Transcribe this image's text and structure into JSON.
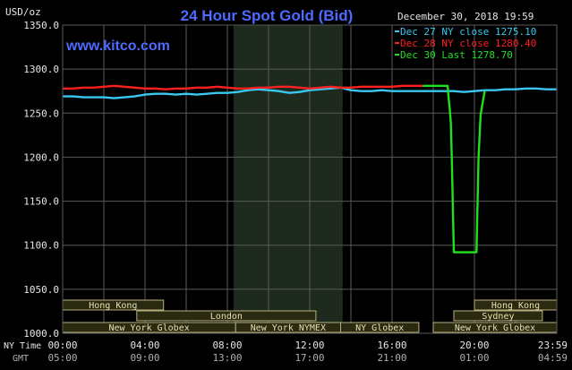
{
  "header": {
    "title": "24 Hour Spot Gold (Bid)",
    "date": "December 30, 2018 19:59",
    "unit": "USD/oz",
    "site": "www.kitco.com"
  },
  "colors": {
    "background": "#000000",
    "grid": "#5a5a5a",
    "title": "#4d6bff",
    "dec27": "#38c8f0",
    "dec28": "#ff2020",
    "dec30": "#20e020",
    "session_fill": "#1e2a1e",
    "market_bar": "#2a2a10",
    "market_border": "#b8b080",
    "market_text": "#e8e0b0",
    "axis_text": "#e6e6e6",
    "subtle_text": "#b0b0b0"
  },
  "legend": [
    {
      "label": "Dec 27 NY close 1275.10",
      "color": "#38c8f0"
    },
    {
      "label": "Dec 28 NY close 1280.40",
      "color": "#ff2020"
    },
    {
      "label": "Dec 30 Last 1278.70",
      "color": "#20e020"
    }
  ],
  "axis_labels": {
    "ny_time": "NY Time",
    "gmt": "GMT"
  },
  "chart_data": {
    "type": "line",
    "xlim": [
      0,
      24
    ],
    "ylim": [
      1000,
      1350
    ],
    "yticks": [
      1000,
      1050,
      1100,
      1150,
      1200,
      1250,
      1300,
      1350
    ],
    "ytick_labels": [
      "1000.0",
      "1050.0",
      "1100.0",
      "1150.0",
      "1200.0",
      "1250.0",
      "1300.0",
      "1350.0"
    ],
    "xticks": [
      0,
      4,
      8,
      12,
      16,
      20,
      23.983
    ],
    "xtick_labels": [
      "00:00",
      "04:00",
      "08:00",
      "12:00",
      "16:00",
      "20:00",
      "23:59"
    ],
    "gmt_labels": [
      "05:00",
      "09:00",
      "13:00",
      "17:00",
      "21:00",
      "01:00",
      "04:59"
    ],
    "grid": true,
    "shaded_session": [
      8.3,
      13.6
    ],
    "series": [
      {
        "name": "Dec 27 NY close 1275.10",
        "color": "#38c8f0",
        "x": [
          0,
          0.5,
          1,
          1.5,
          2,
          2.5,
          3,
          3.5,
          4,
          4.5,
          5,
          5.5,
          6,
          6.5,
          7,
          7.5,
          8,
          8.5,
          9,
          9.5,
          10,
          10.5,
          11,
          11.5,
          12,
          12.5,
          13,
          13.5,
          14,
          14.5,
          15,
          15.5,
          16,
          16.5,
          17,
          17.5,
          18,
          18.5,
          19,
          19.5,
          20,
          20.5,
          21,
          21.5,
          22,
          22.5,
          23,
          23.5,
          24
        ],
        "y": [
          1269,
          1269,
          1268,
          1268,
          1268,
          1267,
          1268,
          1269,
          1271,
          1272,
          1272,
          1271,
          1272,
          1271,
          1272,
          1273,
          1273,
          1274,
          1276,
          1277,
          1276,
          1275,
          1273,
          1274,
          1276,
          1277,
          1278,
          1279,
          1276,
          1275,
          1275,
          1276,
          1275,
          1275,
          1275,
          1275,
          1275,
          1275,
          1275,
          1274,
          1275,
          1276,
          1276,
          1277,
          1277,
          1278,
          1278,
          1277,
          1277
        ]
      },
      {
        "name": "Dec 28 NY close 1280.40",
        "color": "#ff2020",
        "x": [
          0,
          0.5,
          1,
          1.5,
          2,
          2.5,
          3,
          3.5,
          4,
          4.5,
          5,
          5.5,
          6,
          6.5,
          7,
          7.5,
          8,
          8.5,
          9,
          9.5,
          10,
          10.5,
          11,
          11.5,
          12,
          12.5,
          13,
          13.5,
          14,
          14.5,
          15,
          15.5,
          16,
          16.5,
          17,
          17.5
        ],
        "y": [
          1278,
          1278,
          1279,
          1279,
          1280,
          1281,
          1280,
          1279,
          1278,
          1278,
          1277,
          1278,
          1278,
          1279,
          1279,
          1280,
          1279,
          1278,
          1278,
          1279,
          1279,
          1280,
          1280,
          1279,
          1278,
          1279,
          1280,
          1279,
          1279,
          1280,
          1280,
          1280,
          1280,
          1281,
          1281,
          1281
        ]
      },
      {
        "name": "Dec 30 Last 1278.70",
        "color": "#20e020",
        "x": [
          17.5,
          18.7,
          18.75,
          18.8,
          18.85,
          18.9,
          19.0,
          20.1,
          20.2,
          20.3,
          20.4,
          20.5
        ],
        "y": [
          1281,
          1281,
          1266,
          1255,
          1240,
          1200,
          1092,
          1092,
          1200,
          1248,
          1262,
          1275
        ]
      }
    ]
  },
  "markets": [
    {
      "label": "Hong Kong",
      "start": 0,
      "end": 4.9
    },
    {
      "label": "London",
      "start": 3.6,
      "end": 12.3
    },
    {
      "label": "New York Globex",
      "start": 0,
      "end": 8.4
    },
    {
      "label": "New York NYMEX",
      "start": 8.4,
      "end": 13.5
    },
    {
      "label": "NY Globex",
      "start": 13.5,
      "end": 17.3
    },
    {
      "label": "Hong Kong",
      "start": 20.0,
      "end": 24
    },
    {
      "label": "Sydney",
      "start": 19.0,
      "end": 23.3
    },
    {
      "label": "New York Globex",
      "start": 18.0,
      "end": 24
    }
  ]
}
